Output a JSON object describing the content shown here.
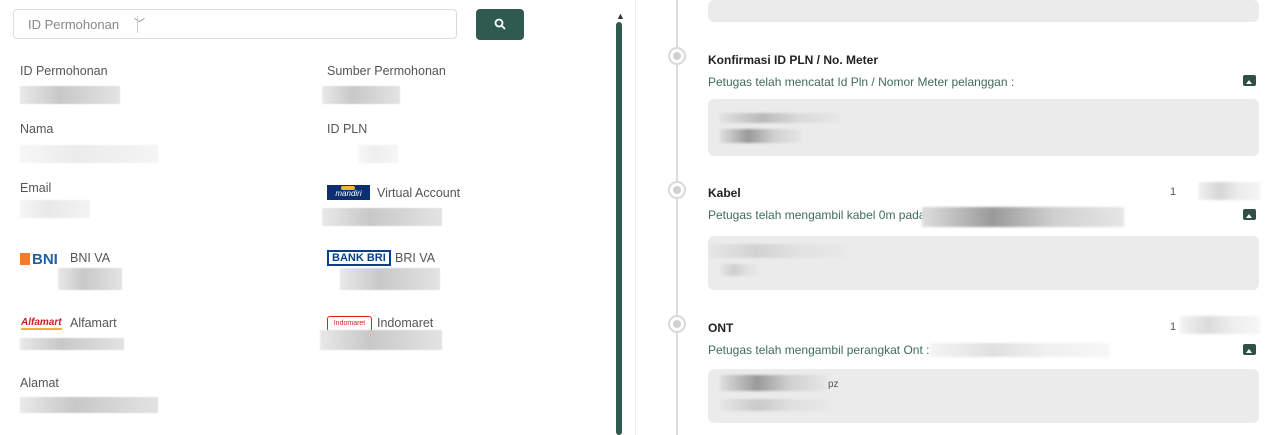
{
  "search": {
    "filter_label": "ID Permohonan",
    "value": ""
  },
  "fields": {
    "id_permohonan": {
      "label": "ID Permohonan"
    },
    "sumber": {
      "label": "Sumber Permohonan"
    },
    "nama": {
      "label": "Nama"
    },
    "id_pln": {
      "label": "ID PLN"
    },
    "email": {
      "label": "Email"
    },
    "va": {
      "label": "Virtual Account"
    },
    "bni": {
      "label": "BNI VA"
    },
    "bri": {
      "label": "BRI VA"
    },
    "alfamart": {
      "label": "Alfamart"
    },
    "indomaret": {
      "label": "Indomaret"
    },
    "alamat": {
      "label": "Alamat"
    }
  },
  "logos": {
    "bni": "BNI",
    "bri": "BANK BRI",
    "mandiri": "mandiri",
    "alfamart": "Alfamart",
    "indomaret": "Indomaret"
  },
  "timeline": [
    {
      "title": "Konfirmasi ID PLN / No. Meter",
      "desc": "Petugas telah mencatat Id Pln / Nomor Meter pelanggan :"
    },
    {
      "title": "Kabel",
      "desc": "Petugas telah mengambil kabel 0m pada",
      "date": "1"
    },
    {
      "title": "ONT",
      "desc": "Petugas telah mengambil perangkat Ont :",
      "date": "1",
      "card_text": "pz"
    }
  ],
  "colors": {
    "accent": "#2f5a4f",
    "desc": "#3f6b60"
  }
}
